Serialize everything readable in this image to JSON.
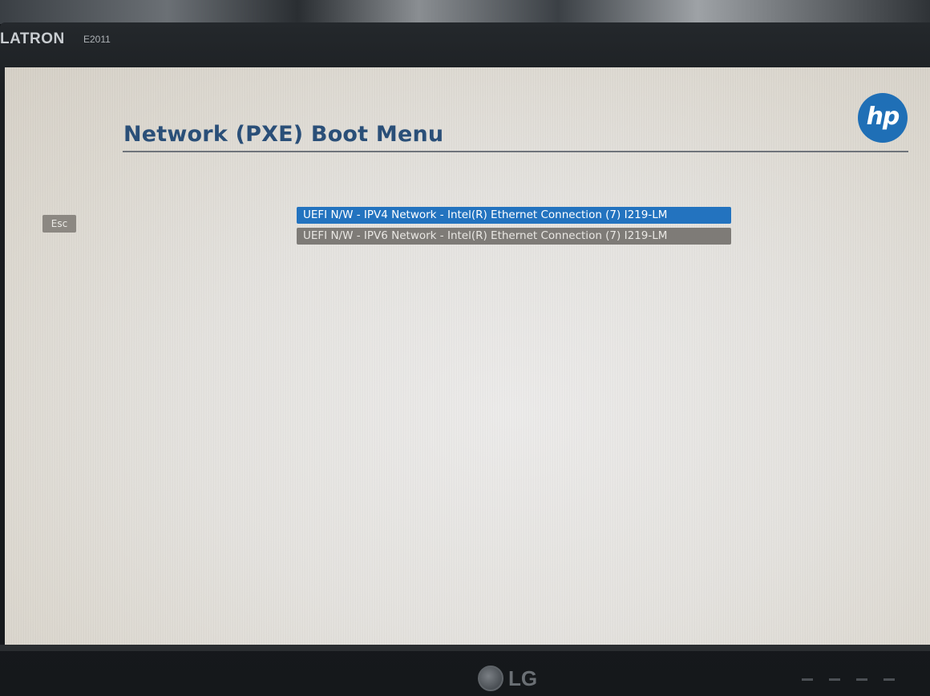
{
  "monitor": {
    "brand": "LATRON",
    "model": "E2011",
    "manufacturer_logo": "LG"
  },
  "screen": {
    "title": "Network (PXE) Boot Menu",
    "vendor_logo": "hp",
    "esc_label": "Esc",
    "boot_options": [
      {
        "label": "UEFI N/W - IPV4 Network - Intel(R) Ethernet Connection (7) I219-LM",
        "selected": true
      },
      {
        "label": "UEFI N/W - IPV6 Network - Intel(R) Ethernet Connection (7) I219-LM",
        "selected": false
      }
    ]
  },
  "colors": {
    "title": "#2a4f78",
    "selected_option": "#2373bf",
    "unselected_option": "#7e7b77",
    "hp_logo": "#1f6fb6",
    "screen_background": "#e4e2de"
  }
}
